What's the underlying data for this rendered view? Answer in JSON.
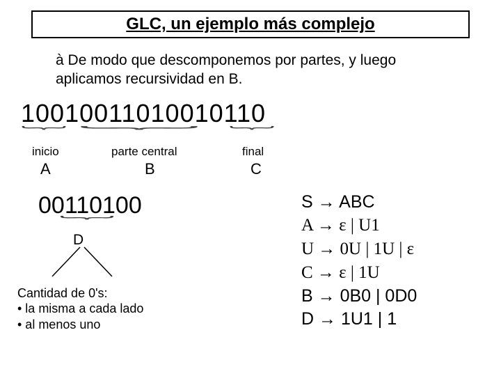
{
  "title": "GLC, un ejemplo más complejo",
  "intro_arrow": "à",
  "intro_text": " De modo que descomponemos por partes, y luego aplicamos recursividad en B.",
  "big_binary": "10010011010010110",
  "seg_labels": {
    "inicio": "inicio",
    "central": "parte central",
    "final": "final",
    "A": "A",
    "B": "B",
    "C": "C"
  },
  "mid_binary": "00110100",
  "D_label": "D",
  "notes": {
    "header": "Cantidad de 0's:",
    "b1": "• la misma a cada lado",
    "b2": "• al menos uno"
  },
  "grammar": {
    "S": "S → ABC",
    "A": "A → ε | U1",
    "U": "U → 0U | 1U | ε",
    "C": "C → ε | 1U",
    "B": "B → 0B0 | 0D0",
    "D": "D → 1U1 | 1"
  }
}
